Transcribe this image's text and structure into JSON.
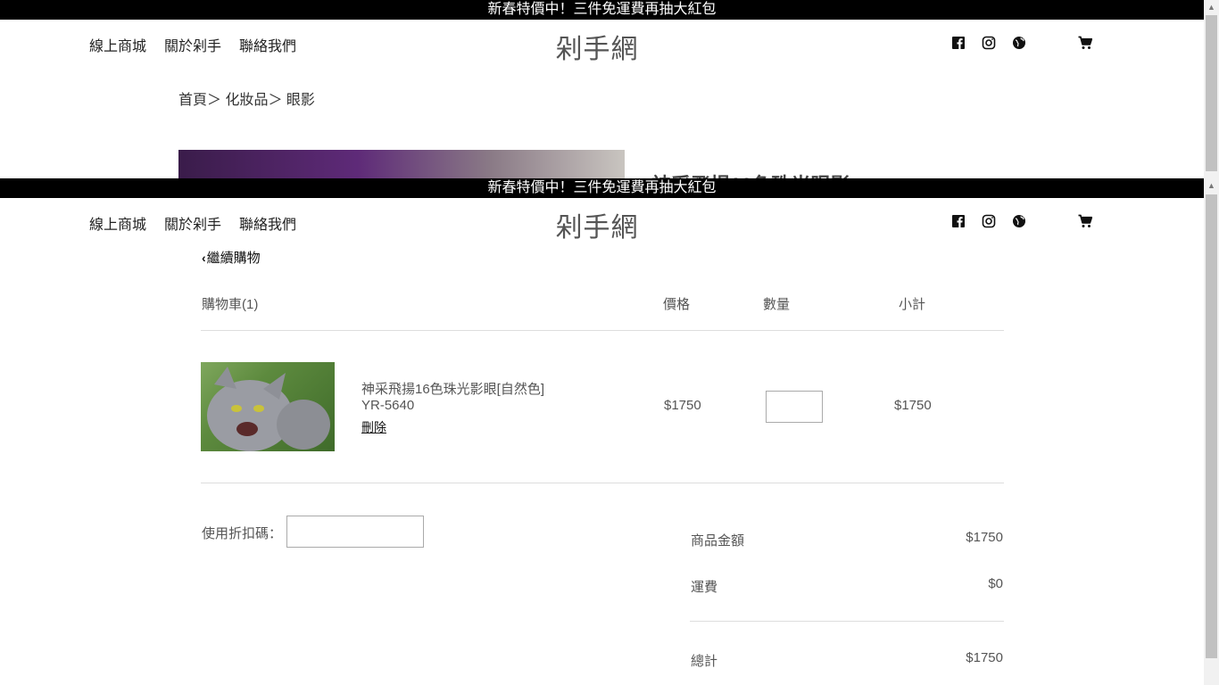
{
  "promo": {
    "text": "新春特價中！三件免運費再抽大紅包"
  },
  "nav": {
    "shop": "線上商城",
    "about": "關於剁手",
    "contact": "聯絡我們"
  },
  "brand": "剁手網",
  "icons": [
    "facebook-icon",
    "instagram-icon",
    "globe-icon",
    "cart-icon"
  ],
  "background_page": {
    "breadcrumb": "首頁＞ 化妝品＞ 眼影"
  },
  "cart": {
    "continue_label": "繼續購物",
    "headers": {
      "cart": "購物車(1)",
      "price": "價格",
      "quantity": "數量",
      "subtotal": "小計"
    },
    "items": [
      {
        "name": "神采飛揚16色珠光影眼[自然色]",
        "sku": "YR-5640",
        "delete_label": "刪除",
        "price": "$1750",
        "quantity": "",
        "subtotal": "$1750"
      }
    ],
    "coupon": {
      "label": "使用折扣碼：",
      "value": ""
    },
    "summary": {
      "goods_label": "商品金額",
      "goods_value": "$1750",
      "shipping_label": "運費",
      "shipping_value": "$0",
      "total_label": "總計",
      "total_value": "$1750"
    }
  }
}
